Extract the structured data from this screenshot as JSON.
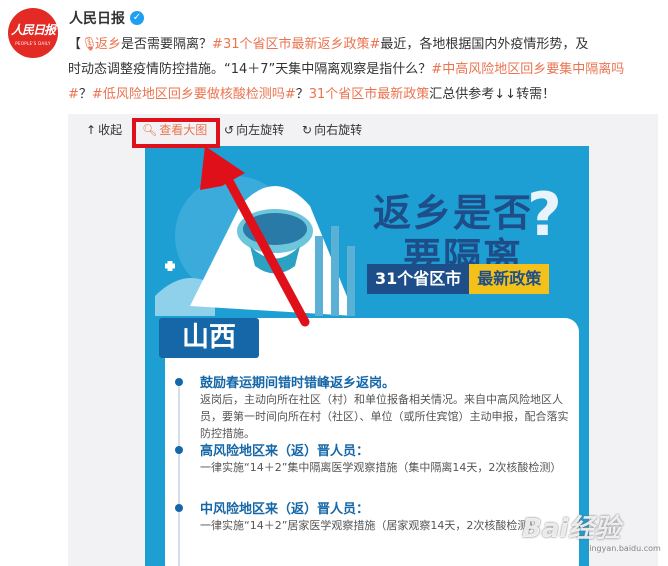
{
  "account": {
    "name": "人民日报",
    "logo_text": "人民日报",
    "logo_subtext": "PEOPLE'S DAILY",
    "verified_mark": "✓"
  },
  "post": {
    "bracket_open": "【",
    "topic_link": "返乡",
    "q1": "是否需要隔离？",
    "hashtag1": "#31个省区市最新返乡政策#",
    "text1": "最近，各地根据国内外疫情形势，及",
    "line2": "时动态调整疫情防控措施。“14＋7”天集中隔离观察是指什么？",
    "hashtag2": "#中高风险地区回乡要集中隔离吗",
    "hashtag2b": "#",
    "q2": "？",
    "hashtag3": "#低风险地区回乡要做核酸检测吗#",
    "q3": "？",
    "policy_link": "31个省区市最新政策",
    "text_end": "汇总供参考↓↓转需！"
  },
  "toolbar": {
    "collapse": "收起",
    "view_large": "查看大图",
    "rotate_left": "向左旋转",
    "rotate_right": "向右旋转"
  },
  "poster": {
    "title_line1": "返乡是否",
    "title_line2": "要隔离",
    "question_mark": "?",
    "sub_a": "31个省区市",
    "sub_b": "最新政策",
    "province": "山西",
    "s1_title": "鼓励春运期间错时错峰返乡返岗。",
    "s1_body": "返岗后，主动向所在社区（村）和单位报备相关情况。来自中高风险地区人员，要第一时间向所在村（社区）、单位（或所住宾馆）主动申报，配合落实防控措施。",
    "s2_title": "高风险地区来（返）晋人员：",
    "s2_body": "一律实施“14＋2”集中隔离医学观察措施（集中隔离14天，2次核酸检测）",
    "s3_title": "中风险地区来（返）晋人员：",
    "s3_body": "一律实施“14＋2”居家医学观察措施（居家观察14天，2次核酸检测）",
    "watermark": "Bai经验",
    "watermark_sub": "jingyan.baidu.com"
  },
  "colors": {
    "link": "#eb7350",
    "annotation_red": "#e0101a",
    "poster_blue": "#1e9fd3",
    "poster_navy": "#1d4e8a",
    "poster_yellow": "#f4c11b"
  }
}
